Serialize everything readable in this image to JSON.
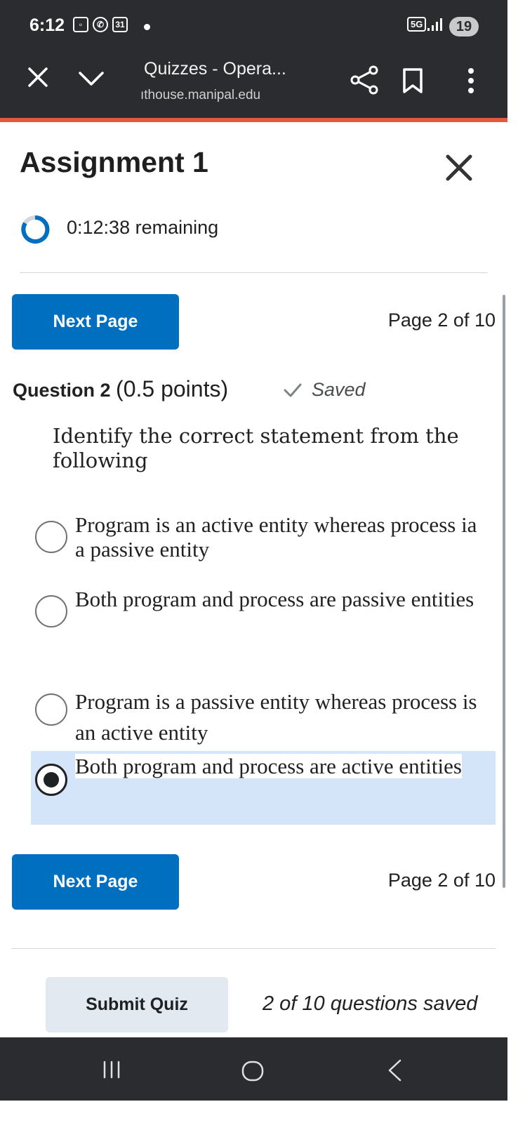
{
  "status_bar": {
    "time": "6:12",
    "calendar_badge": "31",
    "network": "5G",
    "battery": "19"
  },
  "browser": {
    "title": "Quizzes - Opera...",
    "url": "ıthouse.manipal.edu"
  },
  "quiz": {
    "title": "Assignment 1",
    "timer": "0:12:38 remaining",
    "next_page_label": "Next Page",
    "page_indicator": "Page 2 of 10",
    "question": {
      "number": "Question 2",
      "points": "(0.5 points)",
      "status": "Saved",
      "text": "Identify the correct statement from the following",
      "options": [
        {
          "label": "Program is an active entity whereas process ia a passive entity",
          "selected": false
        },
        {
          "label": "Both program and process are passive entities",
          "selected": false
        },
        {
          "label": "Program is a passive entity whereas process is an active entity",
          "selected": false
        },
        {
          "label": "Both program and process are active entities",
          "selected": true
        }
      ]
    },
    "submit_label": "Submit Quiz",
    "saved_count": "2 of 10 questions saved"
  },
  "colors": {
    "primary": "#006fbf",
    "accent": "#e35b3f",
    "selected_bg": "#d4e5f9",
    "chrome": "#2b2c2f"
  }
}
